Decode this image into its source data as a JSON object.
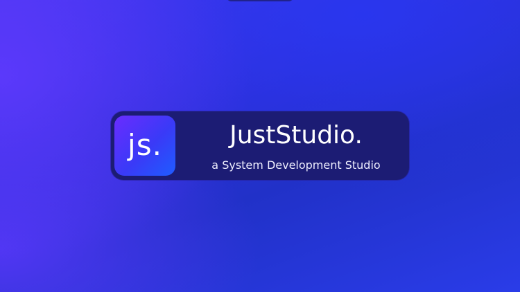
{
  "brand": {
    "logo_text": "js.",
    "name": "JustStudio.",
    "tagline": "a System Development Studio"
  },
  "colors": {
    "background_primary": "#2c2fd6",
    "background_accent": "#5a3cf6",
    "card_background": "#1c1c74",
    "logo_gradient_start": "#6a2cff",
    "logo_gradient_end": "#1f5cff",
    "text": "#ffffff"
  }
}
